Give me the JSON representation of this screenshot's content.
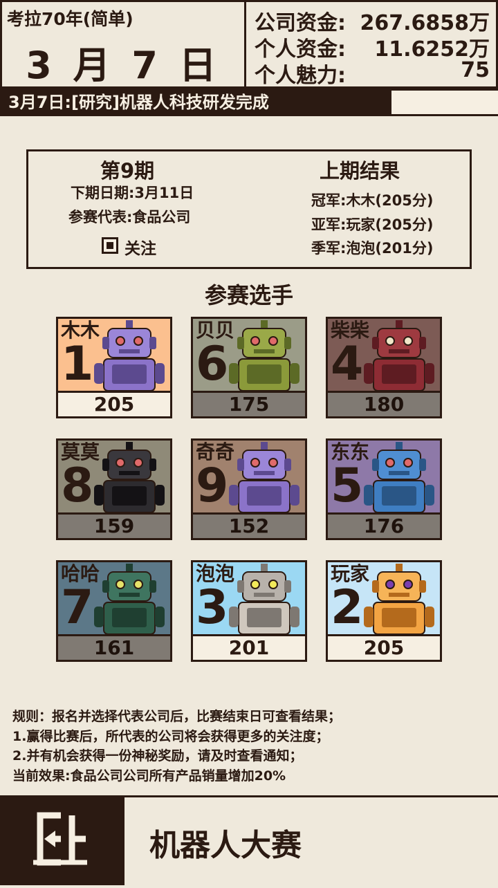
{
  "header": {
    "game_title": "考拉70年(简单)",
    "date": "3 月 7 日",
    "company_funds_label": "公司资金:",
    "company_funds_value": "267.6858万",
    "personal_funds_label": "个人资金:",
    "personal_funds_value": "11.6252万",
    "charm_label": "个人魅力:",
    "charm_value": "75"
  },
  "news": "3月7日:[研究]机器人科技研发完成",
  "contest": {
    "period": "第9期",
    "next_date": "下期日期:3月11日",
    "representative": "参赛代表:食品公司",
    "follow_label": "关注",
    "follow_checked": true,
    "last_result_title": "上期结果",
    "champion": "冠军:木木(205分)",
    "runner_up": "亚军:玩家(205分)",
    "third": "季军:泡泡(201分)"
  },
  "players_title": "参赛选手",
  "players": [
    {
      "name": "木木",
      "number": "1",
      "score": "205",
      "bg": "#fbc08f",
      "highlight": true,
      "robot": "violet"
    },
    {
      "name": "贝贝",
      "number": "6",
      "score": "175",
      "bg": "#9b9c88",
      "highlight": false,
      "robot": "olive"
    },
    {
      "name": "柴柴",
      "number": "4",
      "score": "180",
      "bg": "#7d5b55",
      "highlight": false,
      "robot": "red"
    },
    {
      "name": "莫莫",
      "number": "8",
      "score": "159",
      "bg": "#8f8a78",
      "highlight": false,
      "robot": "black"
    },
    {
      "name": "奇奇",
      "number": "9",
      "score": "152",
      "bg": "#a1826e",
      "highlight": false,
      "robot": "violet"
    },
    {
      "name": "东东",
      "number": "5",
      "score": "176",
      "bg": "#8e79a8",
      "highlight": false,
      "robot": "blue"
    },
    {
      "name": "哈哈",
      "number": "7",
      "score": "161",
      "bg": "#5c7888",
      "highlight": false,
      "robot": "green"
    },
    {
      "name": "泡泡",
      "number": "3",
      "score": "201",
      "bg": "#9bd8f3",
      "highlight": true,
      "robot": "silver"
    },
    {
      "name": "玩家",
      "number": "2",
      "score": "205",
      "bg": "#c6e5f7",
      "highlight": true,
      "robot": "orange"
    }
  ],
  "rules": [
    "规则：报名并选择代表公司后，比赛结束日可查看结果；",
    "1.赢得比赛后，所代表的公司将会获得更多的关注度；",
    "2.并有机会获得一份神秘奖励，请及时查看通知；",
    "当前效果:食品公司公司所有产品销量增加20%"
  ],
  "footer_title": "机器人大赛",
  "exit_icon": "exit-door-icon"
}
